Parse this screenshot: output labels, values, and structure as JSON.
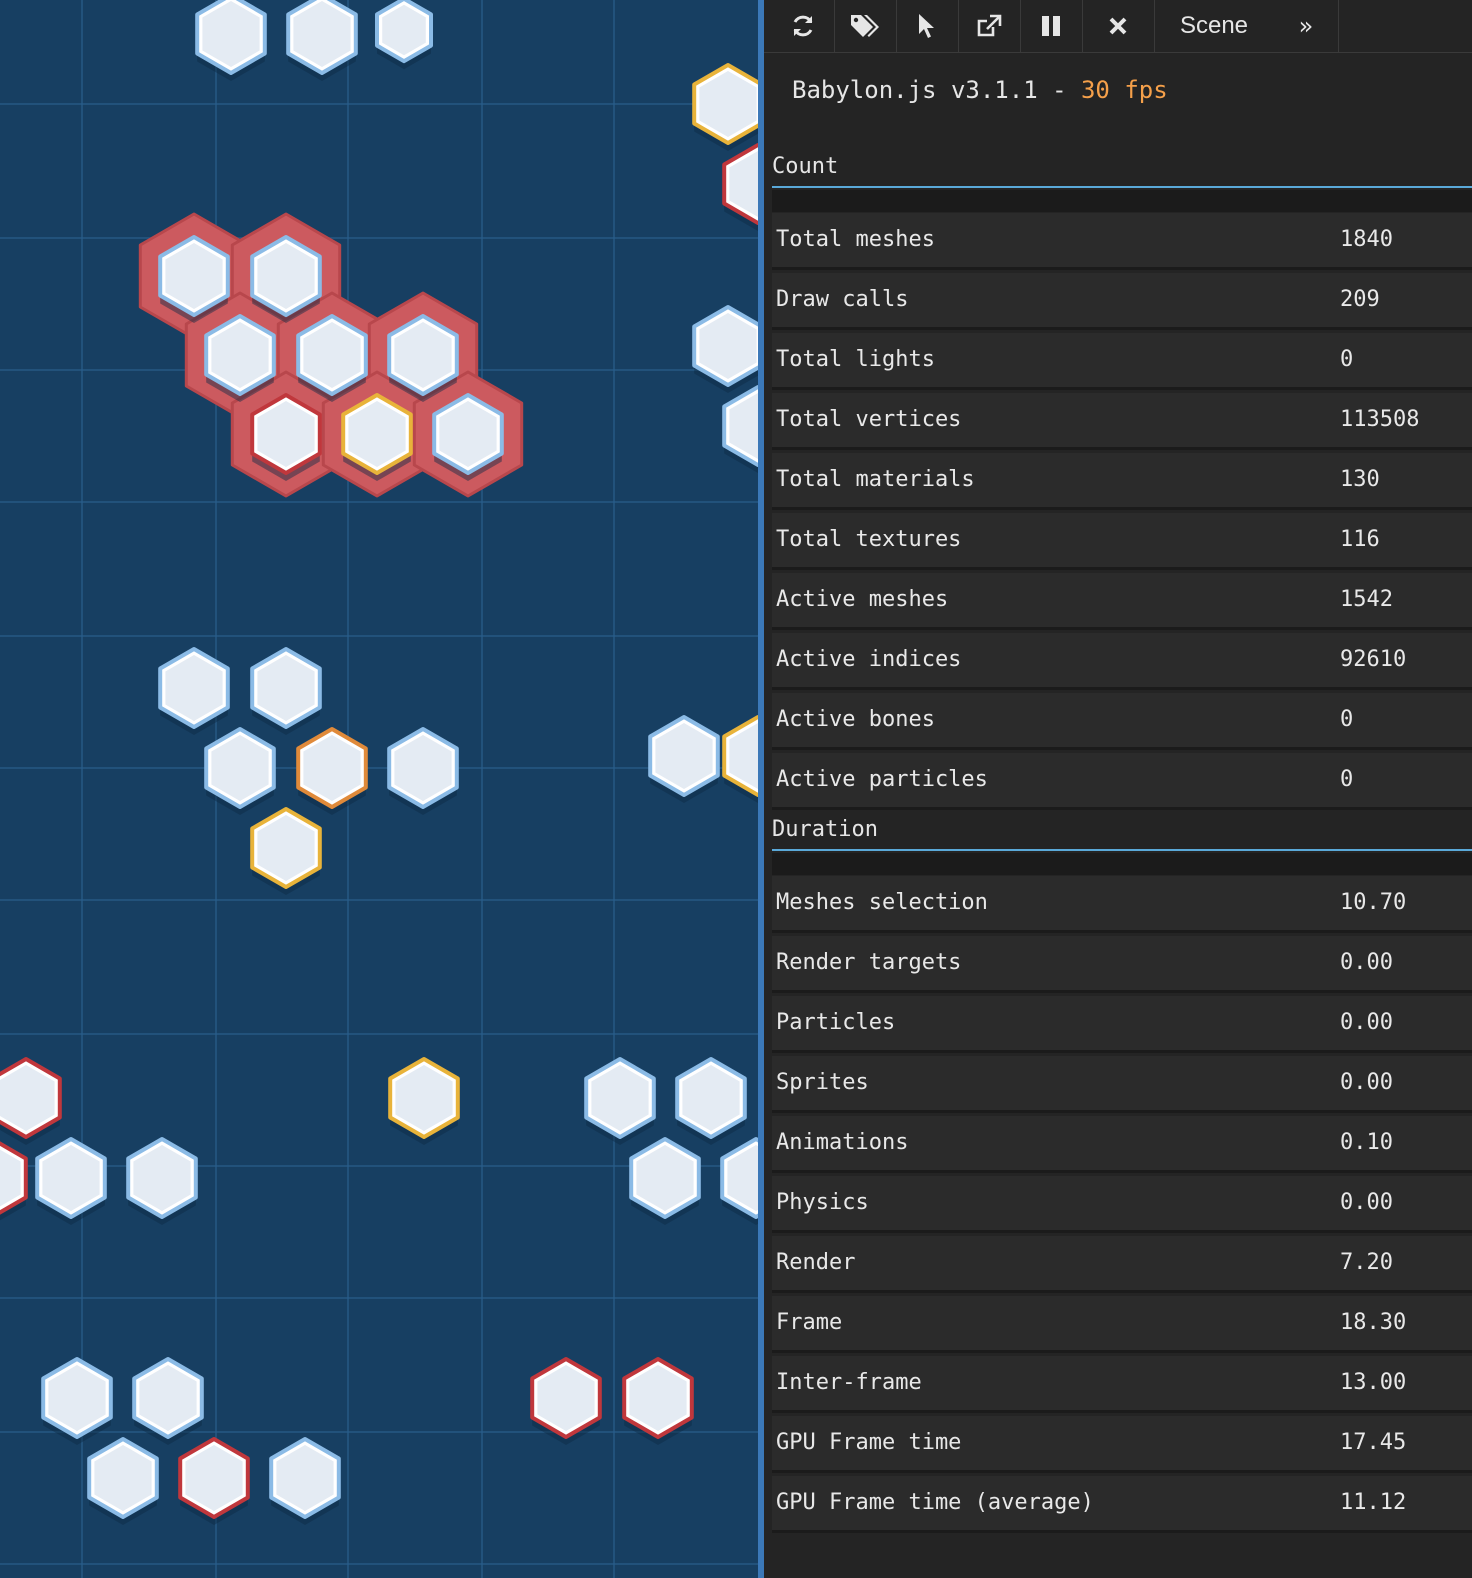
{
  "scene": {
    "background": "#173f62",
    "grid_color": "#2a5f8c",
    "colors": {
      "blue": "#8bbbe6",
      "red": "#c0373c",
      "gold": "#e8b33a",
      "orange": "#e08a3a",
      "highlight": "#cc5a5f"
    }
  },
  "toolbar": {
    "icons": [
      "refresh-icon",
      "tags-icon",
      "pointer-icon",
      "external-link-icon",
      "pause-icon",
      "close-icon"
    ],
    "tab_label": "Scene",
    "more_label": "»"
  },
  "header": {
    "engine": "Babylon.js v3.1.1 - ",
    "fps": "30 fps"
  },
  "sections": {
    "count": {
      "title": "Count",
      "rows": [
        {
          "label": "Total meshes",
          "value": "1840"
        },
        {
          "label": "Draw calls",
          "value": "209"
        },
        {
          "label": "Total lights",
          "value": "0"
        },
        {
          "label": "Total vertices",
          "value": "113508"
        },
        {
          "label": "Total materials",
          "value": "130"
        },
        {
          "label": "Total textures",
          "value": "116"
        },
        {
          "label": "Active meshes",
          "value": "1542"
        },
        {
          "label": "Active indices",
          "value": "92610"
        },
        {
          "label": "Active bones",
          "value": "0"
        },
        {
          "label": "Active particles",
          "value": "0"
        }
      ]
    },
    "duration": {
      "title": "Duration",
      "rows": [
        {
          "label": "Meshes selection",
          "value": "10.70"
        },
        {
          "label": "Render targets",
          "value": "0.00"
        },
        {
          "label": "Particles",
          "value": "0.00"
        },
        {
          "label": "Sprites",
          "value": "0.00"
        },
        {
          "label": "Animations",
          "value": "0.10"
        },
        {
          "label": "Physics",
          "value": "0.00"
        },
        {
          "label": "Render",
          "value": "7.20"
        },
        {
          "label": "Frame",
          "value": "18.30"
        },
        {
          "label": "Inter-frame",
          "value": "13.00"
        },
        {
          "label": "GPU Frame time",
          "value": "17.45"
        },
        {
          "label": "GPU Frame time (average)",
          "value": "11.12"
        }
      ]
    }
  }
}
